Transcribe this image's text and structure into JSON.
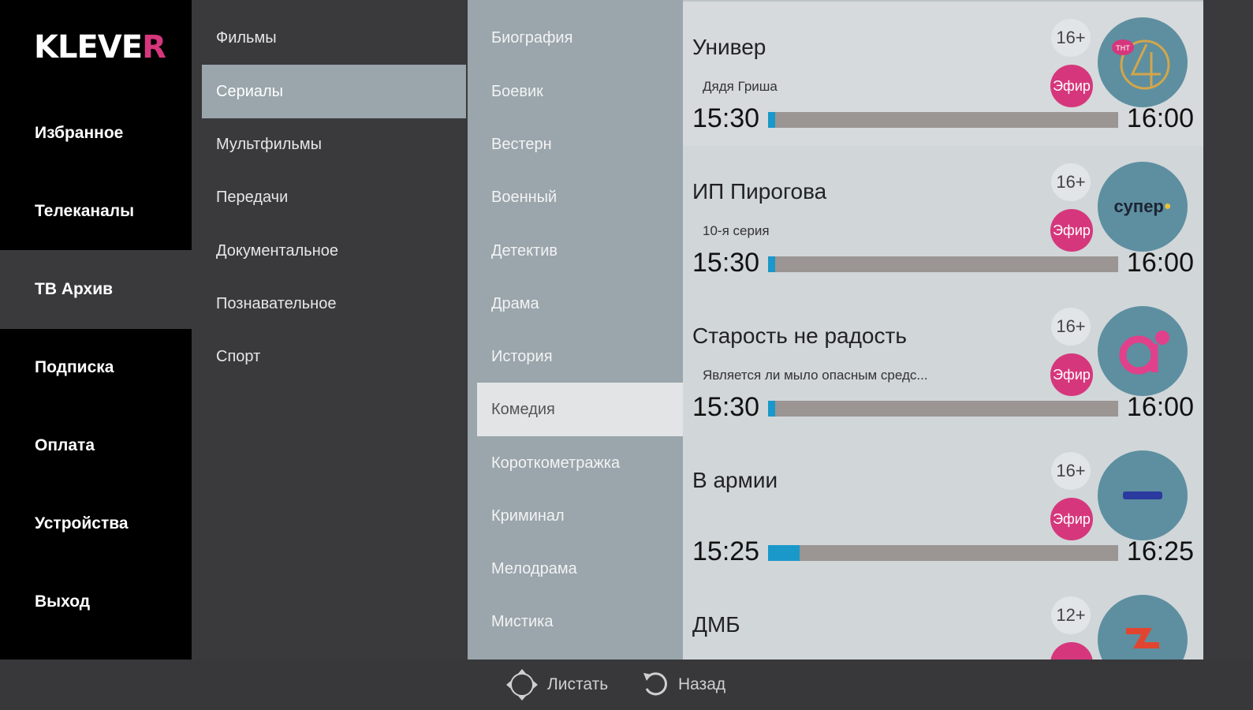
{
  "app": {
    "logo_main": "KLEVE",
    "logo_accent": "R"
  },
  "nav": [
    {
      "label": "Избранное"
    },
    {
      "label": "Телеканалы"
    },
    {
      "label": "ТВ Архив",
      "active": true
    },
    {
      "label": "Подписка"
    },
    {
      "label": "Оплата"
    },
    {
      "label": "Устройства"
    },
    {
      "label": "Выход"
    }
  ],
  "categories": [
    {
      "label": "Фильмы"
    },
    {
      "label": "Сериалы",
      "active": true
    },
    {
      "label": "Мультфильмы"
    },
    {
      "label": "Передачи"
    },
    {
      "label": "Документальное"
    },
    {
      "label": "Познавательное"
    },
    {
      "label": "Спорт"
    }
  ],
  "genres": [
    {
      "label": "Биография"
    },
    {
      "label": "Боевик"
    },
    {
      "label": "Вестерн"
    },
    {
      "label": "Военный"
    },
    {
      "label": "Детектив"
    },
    {
      "label": "Драма"
    },
    {
      "label": "История"
    },
    {
      "label": "Комедия",
      "active": true
    },
    {
      "label": "Короткометражка"
    },
    {
      "label": "Криминал"
    },
    {
      "label": "Мелодрама"
    },
    {
      "label": "Мистика"
    }
  ],
  "programs": [
    {
      "title": "Универ",
      "subtitle": "Дядя Гриша",
      "start": "15:30",
      "end": "16:00",
      "progress": 0.02,
      "rating": "16+",
      "live": "Эфир",
      "channel_icon": "tnt4-logo-icon"
    },
    {
      "title": "ИП Пирогова",
      "subtitle": "10-я серия",
      "start": "15:30",
      "end": "16:00",
      "progress": 0.02,
      "rating": "16+",
      "live": "Эфир",
      "channel_icon": "super-logo-icon",
      "channel_text": "супер"
    },
    {
      "title": "Старость не радость",
      "subtitle": "Является ли мыло опасным средс...",
      "start": "15:30",
      "end": "16:00",
      "progress": 0.02,
      "rating": "16+",
      "live": "Эфир",
      "channel_icon": "a2-logo-icon"
    },
    {
      "title": "В армии",
      "subtitle": "",
      "start": "15:25",
      "end": "16:25",
      "progress": 0.09,
      "rating": "16+",
      "live": "Эфир",
      "channel_icon": "channel-logo-icon"
    },
    {
      "title": "ДМБ",
      "subtitle": "",
      "start": "",
      "end": "",
      "progress": 0,
      "rating": "12+",
      "live": "",
      "channel_icon": "che-logo-icon"
    }
  ],
  "footer": {
    "scroll_label": "Листать",
    "back_label": "Назад"
  },
  "colors": {
    "accent": "#d6377c",
    "progress": "#1a98c9",
    "nav_bg": "#000000",
    "genre_bg": "#9aa5ac"
  }
}
